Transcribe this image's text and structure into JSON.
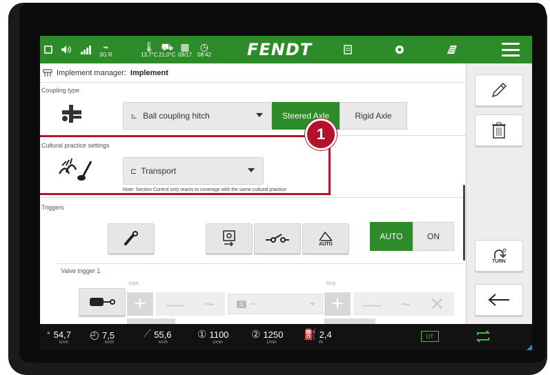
{
  "statusbar": {
    "gps_label": "3G R",
    "temp_outside": "13,7°C",
    "temp_cab": "21,0°C",
    "date": "09/17",
    "time": "08:42",
    "brand": "FENDT"
  },
  "header": {
    "prefix": "Implement manager:",
    "title": "Implement"
  },
  "coupling": {
    "section_label": "Coupling type",
    "dropdown_value": "Ball coupling hitch",
    "steered_axle": "Steered Axle",
    "rigid_axle": "Rigid Axle"
  },
  "cultural": {
    "section_label": "Cultural practice settings",
    "dropdown_value": "Transport",
    "note": "Note: Section Control only reacts to coverage with the same cultural practice"
  },
  "callout": {
    "number": "1"
  },
  "triggers": {
    "section_label": "Triggers",
    "auto_icon_label": "AUTO",
    "toggle_auto": "AUTO",
    "toggle_on": "ON"
  },
  "valve": {
    "label": "Valve trigger 1",
    "start_label": "Start",
    "stop_label": "Stop",
    "select_value": "1"
  },
  "rightpanel": {
    "turn_label": "TURN"
  },
  "bottombar": {
    "speed": "54,7",
    "speed_unit": "km/h",
    "rpm_speed": "7,5",
    "rpm_unit": "km/h",
    "distance": "55,6",
    "distance_unit": "km/h",
    "pto1": "1100",
    "pto1_unit": "1/min",
    "pto2": "1250",
    "pto2_unit": "1/min",
    "fuel": "2,4",
    "fuel_unit": "l/h",
    "ut_label": "UT"
  },
  "colors": {
    "brand_green": "#2d8b2a",
    "highlight_red": "#b3122a",
    "bottombar_bg": "#121212"
  }
}
